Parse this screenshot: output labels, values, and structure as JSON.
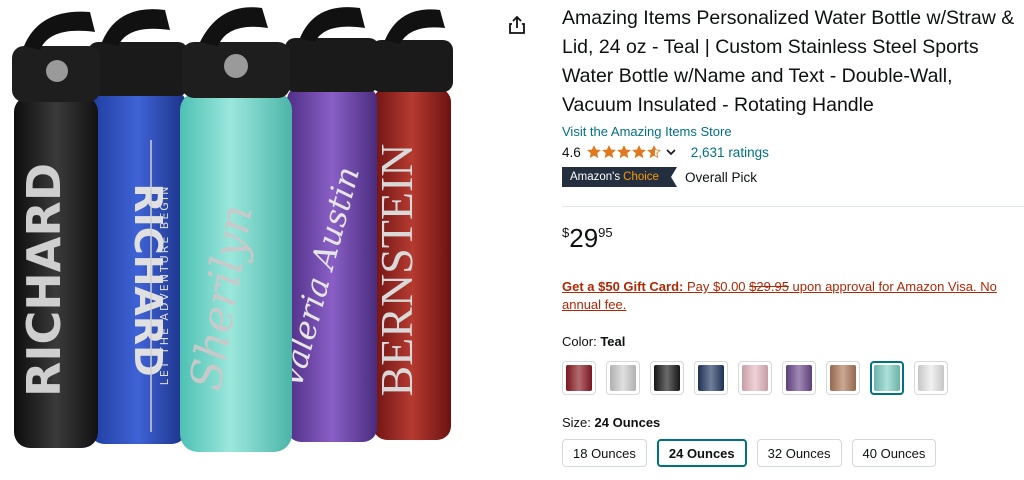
{
  "product": {
    "title": "Amazing Items Personalized Water Bottle w/Straw & Lid, 24 oz - Teal | Custom Stainless Steel Sports Water Bottle w/Name and Text - Double-Wall, Vacuum Insulated - Rotating Handle",
    "store_link": "Visit the Amazing Items Store",
    "rating_value": "4.6",
    "rating_stars": 4.6,
    "ratings_count": "2,631 ratings",
    "badge_prefix": "Amazon's",
    "badge_choice": "Choice",
    "badge_text": "Overall Pick",
    "price_symbol": "$",
    "price_whole": "29",
    "price_fraction": "95",
    "gift_bold": "Get a $50 Gift Card:",
    "gift_pre": " Pay $0.00 ",
    "gift_strike": "$29.95",
    "gift_post": " upon approval for Amazon Visa. No annual fee.",
    "color_prefix": "Color:",
    "color_value": "Teal",
    "size_prefix": "Size:",
    "size_value": "24 Ounces"
  },
  "image_text": {
    "bottle1": "RICHARD",
    "bottle2_name": "RICHARD",
    "bottle2_tagline": "LET THE ADVENTURE BEGIN",
    "bottle3": "Sherilyn",
    "bottle4": "Valeria Austin",
    "bottle5": "BERNSTEIN"
  },
  "swatches": [
    {
      "name": "Red",
      "color": "#8b1c24"
    },
    {
      "name": "Stainless",
      "color": "#cfcfcf"
    },
    {
      "name": "Black",
      "color": "#1b1b1b"
    },
    {
      "name": "Navy",
      "color": "#243a63"
    },
    {
      "name": "Pink",
      "color": "#e8b9c4"
    },
    {
      "name": "Purple",
      "color": "#6e4a8e"
    },
    {
      "name": "Copper",
      "color": "#b07a5c"
    },
    {
      "name": "Teal",
      "color": "#7fd1c6",
      "selected": true
    },
    {
      "name": "White",
      "color": "#e9e9e9"
    }
  ],
  "sizes": [
    {
      "label": "18 Ounces"
    },
    {
      "label": "24 Ounces",
      "selected": true
    },
    {
      "label": "32 Ounces"
    },
    {
      "label": "40 Ounces"
    }
  ],
  "colors": {
    "link": "#007185",
    "star": "#de7921",
    "deal": "#b12704",
    "badge_bg": "#232f3e",
    "badge_accent": "#ff9900"
  }
}
